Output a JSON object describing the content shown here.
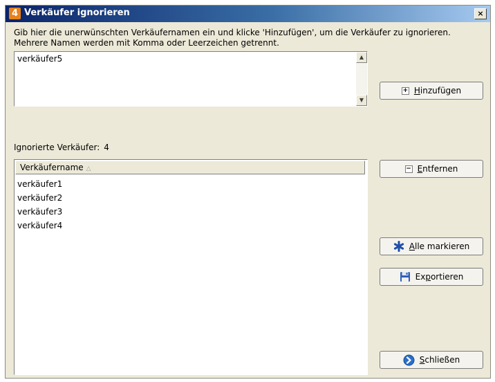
{
  "window": {
    "title": "Verkäufer ignorieren",
    "app_icon_glyph": "4",
    "close_glyph": "×"
  },
  "instruction": "Gib hier die unerwünschten Verkäufernamen ein und klicke 'Hinzufügen', um die Verkäufer zu ignorieren. Mehrere Namen werden mit Komma oder Leerzeichen getrennt.",
  "input": {
    "value": "verkäufer5"
  },
  "buttons": {
    "add": {
      "mnemonic": "H",
      "rest": "inzufügen",
      "icon": "plus-box-icon"
    },
    "remove": {
      "mnemonic": "E",
      "rest": "ntfernen",
      "icon": "minus-box-icon"
    },
    "select_all": {
      "mnemonic": "A",
      "rest": "lle markieren",
      "icon": "asterisk-icon"
    },
    "export": {
      "pre": "Ex",
      "mnemonic": "p",
      "rest": "ortieren",
      "icon": "floppy-disk-icon"
    },
    "close": {
      "mnemonic": "S",
      "rest": "chließen",
      "icon": "close-circle-icon"
    }
  },
  "ignored": {
    "label": "Ignorierte Verkäufer:",
    "count": "4",
    "column_header": "Verkäufername",
    "rows": [
      "verkäufer1",
      "verkäufer2",
      "verkäufer3",
      "verkäufer4"
    ]
  },
  "colors": {
    "dialog_bg": "#ece9d8",
    "title_start": "#0a246a",
    "title_end": "#a6caf0",
    "asterisk": "#1f4fa8",
    "close_icon": "#2a6fc9"
  }
}
